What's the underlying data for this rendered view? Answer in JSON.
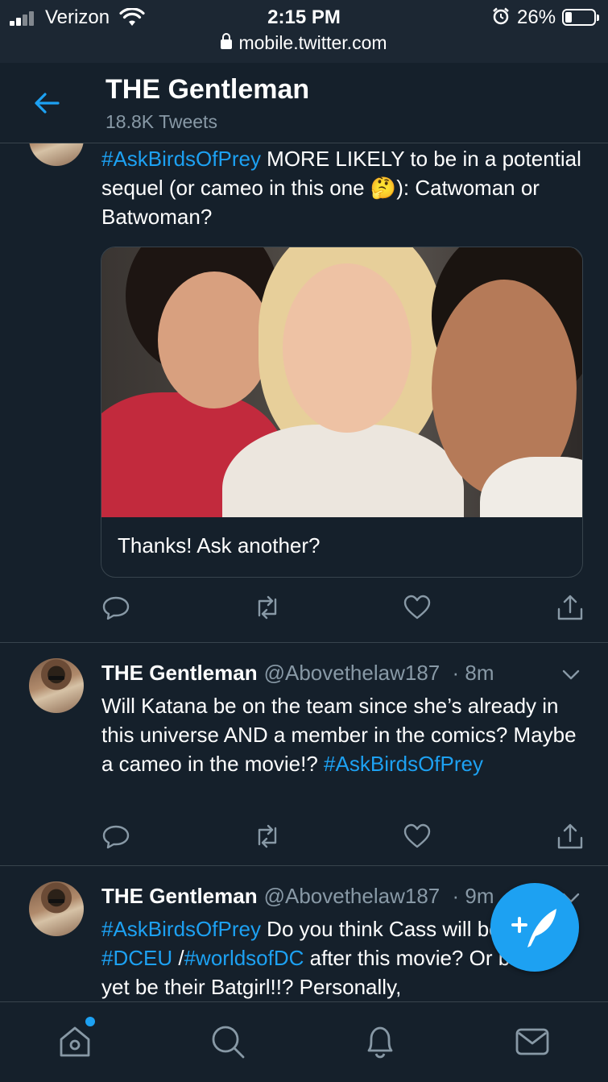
{
  "status_bar": {
    "carrier": "Verizon",
    "time": "2:15 PM",
    "battery_percent": "26%",
    "battery_level": 0.26,
    "url": "mobile.twitter.com",
    "icons": [
      "signal-icon",
      "wifi-icon",
      "alarm-icon",
      "battery-icon",
      "lock-icon"
    ]
  },
  "header": {
    "title": "THE Gentleman",
    "subtitle": "18.8K Tweets",
    "back_icon": "back-arrow-icon"
  },
  "tweets": [
    {
      "text_hashtag": "#AskBirdsOfPrey",
      "text_1": " MORE LIKELY to be in a potential sequel (or cameo in this one ",
      "emoji": "🤔",
      "text_2": "): Catwoman or Batwoman?",
      "media_caption": "Thanks! Ask another?"
    },
    {
      "name": "THE Gentleman",
      "handle": "@Abovethelaw187",
      "time": "· 8m",
      "text": "Will Katana be on the team since she’s already in this universe AND a member in the comics? Maybe a cameo in the movie!? ",
      "hashtag": "#AskBirdsOfPrey"
    },
    {
      "name": "THE Gentleman",
      "handle": "@Abovethelaw187",
      "time": "· 9m",
      "hashtag_1": "#AskBirdsOfPrey",
      "text_1": " Do you think Cass will be in the ",
      "hashtag_2": "#DCEU",
      "text_2": " /",
      "hashtag_3": "#worldsofDC",
      "text_3": " after this movie? Or better yet be their Batgirl!!? Personally,"
    }
  ],
  "actions": [
    "reply-icon",
    "retweet-icon",
    "like-icon",
    "share-icon"
  ],
  "tab_bar": [
    "home-icon",
    "search-icon",
    "notifications-icon",
    "messages-icon"
  ],
  "colors": {
    "background": "#15202b",
    "accent": "#1da1f2",
    "secondary_text": "#8899a6",
    "divider": "#38444d"
  }
}
